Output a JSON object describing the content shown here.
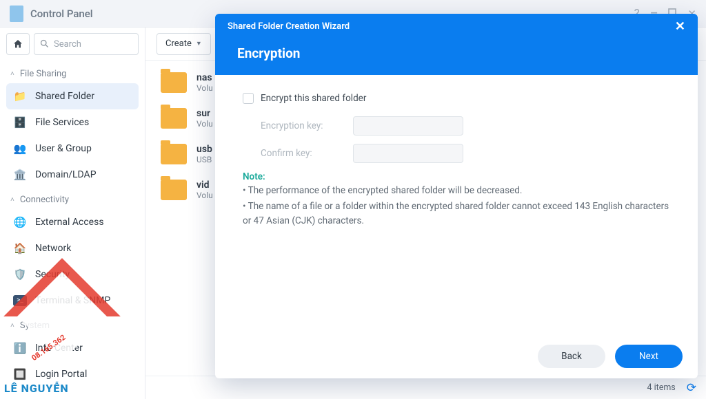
{
  "titlebar": {
    "title": "Control Panel"
  },
  "search": {
    "placeholder": "Search"
  },
  "sections": {
    "file_sharing": {
      "label": "File Sharing",
      "items": [
        {
          "label": "Shared Folder",
          "icon": "folder-user-icon",
          "active": true
        },
        {
          "label": "File Services",
          "icon": "file-box-icon"
        },
        {
          "label": "User & Group",
          "icon": "users-icon"
        },
        {
          "label": "Domain/LDAP",
          "icon": "domain-icon"
        }
      ]
    },
    "connectivity": {
      "label": "Connectivity",
      "items": [
        {
          "label": "External Access",
          "icon": "globe-icon"
        },
        {
          "label": "Network",
          "icon": "house-signal-icon"
        },
        {
          "label": "Security",
          "icon": "shield-icon"
        },
        {
          "label": "Terminal & SNMP",
          "icon": "terminal-icon"
        }
      ]
    },
    "system": {
      "label": "System",
      "items": [
        {
          "label": "Info Center",
          "icon": "info-icon"
        },
        {
          "label": "Login Portal",
          "icon": "portal-icon"
        }
      ]
    }
  },
  "toolbar": {
    "create": "Create"
  },
  "folders": [
    {
      "name": "nas",
      "sub": "Volu"
    },
    {
      "name": "sur",
      "sub": "Volu"
    },
    {
      "name": "usb",
      "sub": "USB"
    },
    {
      "name": "vid",
      "sub": "Volu"
    }
  ],
  "statusbar": {
    "count": "4 items"
  },
  "modal": {
    "wizard_title": "Shared Folder Creation Wizard",
    "heading": "Encryption",
    "encrypt_label": "Encrypt this shared folder",
    "key_label": "Encryption key:",
    "confirm_label": "Confirm key:",
    "note_hd": "Note:",
    "note1": "• The performance of the encrypted shared folder will be decreased.",
    "note2": "• The name of a file or a folder within the encrypted shared folder cannot exceed 143 English characters or 47 Asian (CJK) characters.",
    "back": "Back",
    "next": "Next"
  },
  "watermark": {
    "brand": "LÊ NGUYỄN",
    "phone": "08.165.362"
  }
}
